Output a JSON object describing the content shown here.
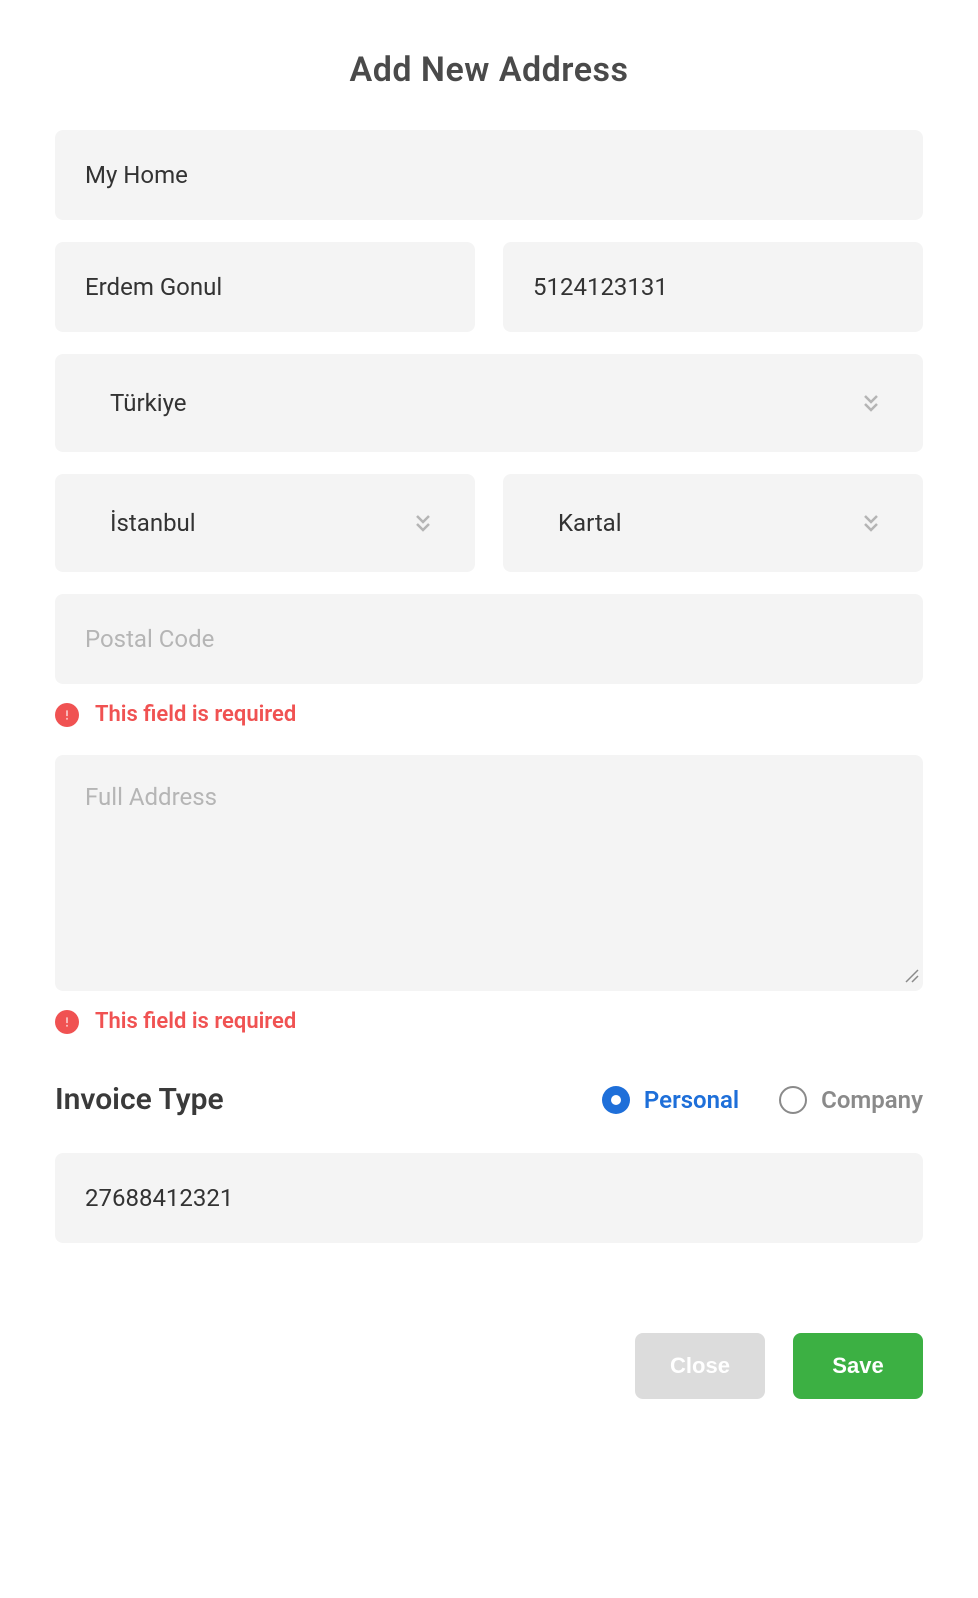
{
  "title": "Add New Address",
  "fields": {
    "label": {
      "value": "My Home"
    },
    "name": {
      "value": "Erdem Gonul"
    },
    "phone": {
      "value": "5124123131"
    },
    "country": {
      "value": "Türkiye"
    },
    "city": {
      "value": "İstanbul"
    },
    "district": {
      "value": "Kartal"
    },
    "postal_code": {
      "value": "",
      "placeholder": "Postal Code"
    },
    "full_address": {
      "value": "",
      "placeholder": "Full Address"
    },
    "tax_id": {
      "value": "27688412321"
    }
  },
  "errors": {
    "postal_code": "This field is required",
    "full_address": "This field is required"
  },
  "invoice": {
    "title": "Invoice Type",
    "options": {
      "personal": "Personal",
      "company": "Company"
    },
    "selected": "personal"
  },
  "buttons": {
    "close": "Close",
    "save": "Save"
  }
}
